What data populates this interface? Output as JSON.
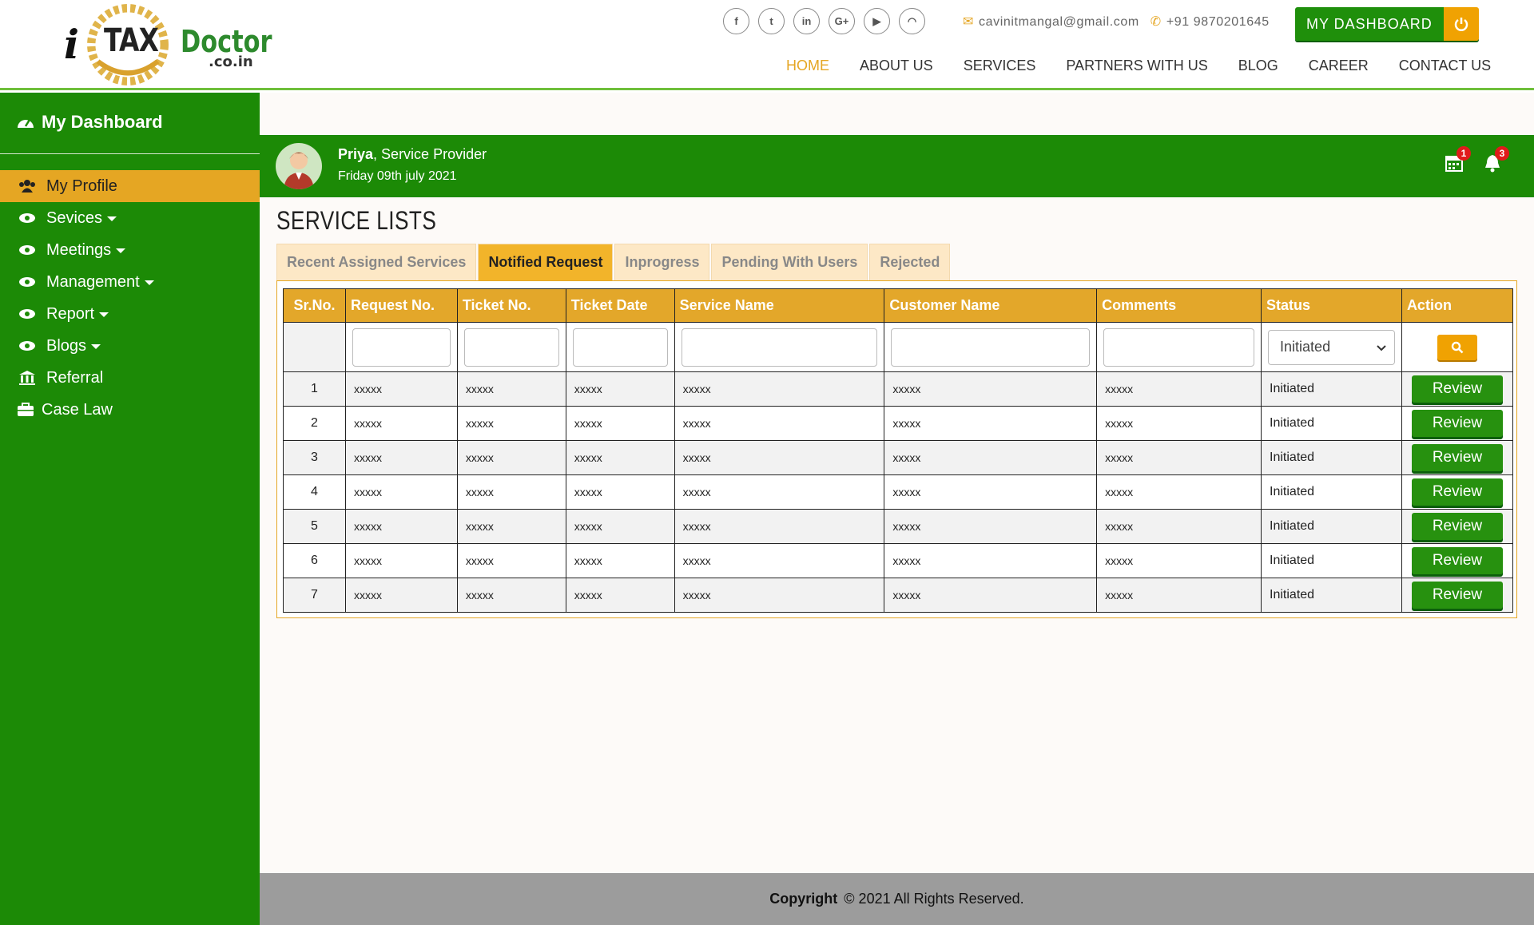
{
  "header": {
    "logo": {
      "i": "i",
      "tax": "TAX",
      "doctor": "Doctor",
      "domain": ".co.in"
    },
    "social": [
      {
        "icon": "facebook-icon",
        "glyph": "f"
      },
      {
        "icon": "twitter-icon",
        "glyph": "t"
      },
      {
        "icon": "linkedin-icon",
        "glyph": "in"
      },
      {
        "icon": "google-plus-icon",
        "glyph": "G+"
      },
      {
        "icon": "youtube-icon",
        "glyph": "▶"
      },
      {
        "icon": "rss-icon",
        "glyph": "◠"
      }
    ],
    "email": "cavinitmangal@gmail.com",
    "phone": "+91 9870201645",
    "dashboard_label": "MY DASHBOARD",
    "nav": [
      "HOME",
      "ABOUT US",
      "SERVICES",
      "PARTNERS WITH US",
      "BLOG",
      "CAREER",
      "CONTACT US"
    ],
    "active_nav": "HOME"
  },
  "sidebar": {
    "title": "My Dashboard",
    "items": [
      {
        "label": "My Profile",
        "icon": "users-icon",
        "active": true,
        "dropdown": false
      },
      {
        "label": "Sevices",
        "icon": "eye-icon",
        "dropdown": true
      },
      {
        "label": "Meetings",
        "icon": "eye-icon",
        "dropdown": true
      },
      {
        "label": "Management",
        "icon": "eye-icon",
        "dropdown": true
      },
      {
        "label": "Report",
        "icon": "eye-icon",
        "dropdown": true
      },
      {
        "label": "Blogs",
        "icon": "eye-icon",
        "dropdown": true
      },
      {
        "label": "Referral",
        "icon": "bank-icon",
        "dropdown": false
      },
      {
        "label": "Case Law",
        "icon": "briefcase-icon",
        "dropdown": false
      }
    ]
  },
  "userbar": {
    "name": "Priya",
    "role": ", Service Provider",
    "date": "Friday 09th july 2021",
    "calendar_count": "1",
    "bell_count": "3"
  },
  "page_title": "SERVICE LISTS",
  "tabs": [
    "Recent Assigned Services",
    "Notified Request",
    "Inprogress",
    "Pending With Users",
    "Rejected"
  ],
  "active_tab": "Notified Request",
  "table": {
    "columns": [
      "Sr.No.",
      "Request No.",
      "Ticket No.",
      "Ticket Date",
      "Service Name",
      "Customer Name",
      "Comments",
      "Status",
      "Action"
    ],
    "status_filter": "Initiated",
    "action_label": "Review",
    "rows": [
      {
        "sr": "1",
        "request": "xxxxx",
        "ticket": "xxxxx",
        "date": "xxxxx",
        "service": "xxxxx",
        "customer": "xxxxx",
        "comments": "xxxxx",
        "status": "Initiated"
      },
      {
        "sr": "2",
        "request": "xxxxx",
        "ticket": "xxxxx",
        "date": "xxxxx",
        "service": "xxxxx",
        "customer": "xxxxx",
        "comments": "xxxxx",
        "status": "Initiated"
      },
      {
        "sr": "3",
        "request": "xxxxx",
        "ticket": "xxxxx",
        "date": "xxxxx",
        "service": "xxxxx",
        "customer": "xxxxx",
        "comments": "xxxxx",
        "status": "Initiated"
      },
      {
        "sr": "4",
        "request": "xxxxx",
        "ticket": "xxxxx",
        "date": "xxxxx",
        "service": "xxxxx",
        "customer": "xxxxx",
        "comments": "xxxxx",
        "status": "Initiated"
      },
      {
        "sr": "5",
        "request": "xxxxx",
        "ticket": "xxxxx",
        "date": "xxxxx",
        "service": "xxxxx",
        "customer": "xxxxx",
        "comments": "xxxxx",
        "status": "Initiated"
      },
      {
        "sr": "6",
        "request": "xxxxx",
        "ticket": "xxxxx",
        "date": "xxxxx",
        "service": "xxxxx",
        "customer": "xxxxx",
        "comments": "xxxxx",
        "status": "Initiated"
      },
      {
        "sr": "7",
        "request": "xxxxx",
        "ticket": "xxxxx",
        "date": "xxxxx",
        "service": "xxxxx",
        "customer": "xxxxx",
        "comments": "xxxxx",
        "status": "Initiated"
      }
    ]
  },
  "footer": {
    "label": "Copyright",
    "text": "© 2021 All Rights Reserved."
  },
  "colors": {
    "green": "#1c8a06",
    "accent": "#e5a623",
    "header_row": "#e3a72a"
  }
}
